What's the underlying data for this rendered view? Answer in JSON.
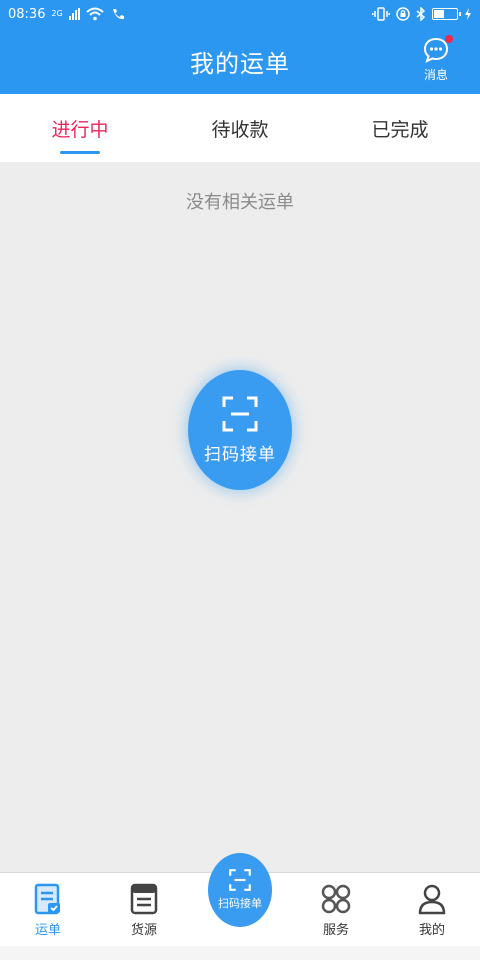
{
  "status": {
    "time": "08:36",
    "network": "2G"
  },
  "header": {
    "title": "我的运单",
    "message_label": "消息"
  },
  "tabs": [
    {
      "label": "进行中",
      "active": true
    },
    {
      "label": "待收款",
      "active": false
    },
    {
      "label": "已完成",
      "active": false
    }
  ],
  "content": {
    "empty_text": "没有相关运单",
    "scan_button_label": "扫码接单"
  },
  "bottom_nav": {
    "waybill": "运单",
    "goods": "货源",
    "scan": "扫码接单",
    "service": "服务",
    "mine": "我的"
  },
  "colors": {
    "primary": "#2c97f0",
    "active_tab": "#e8285a",
    "badge": "#f0284a"
  }
}
